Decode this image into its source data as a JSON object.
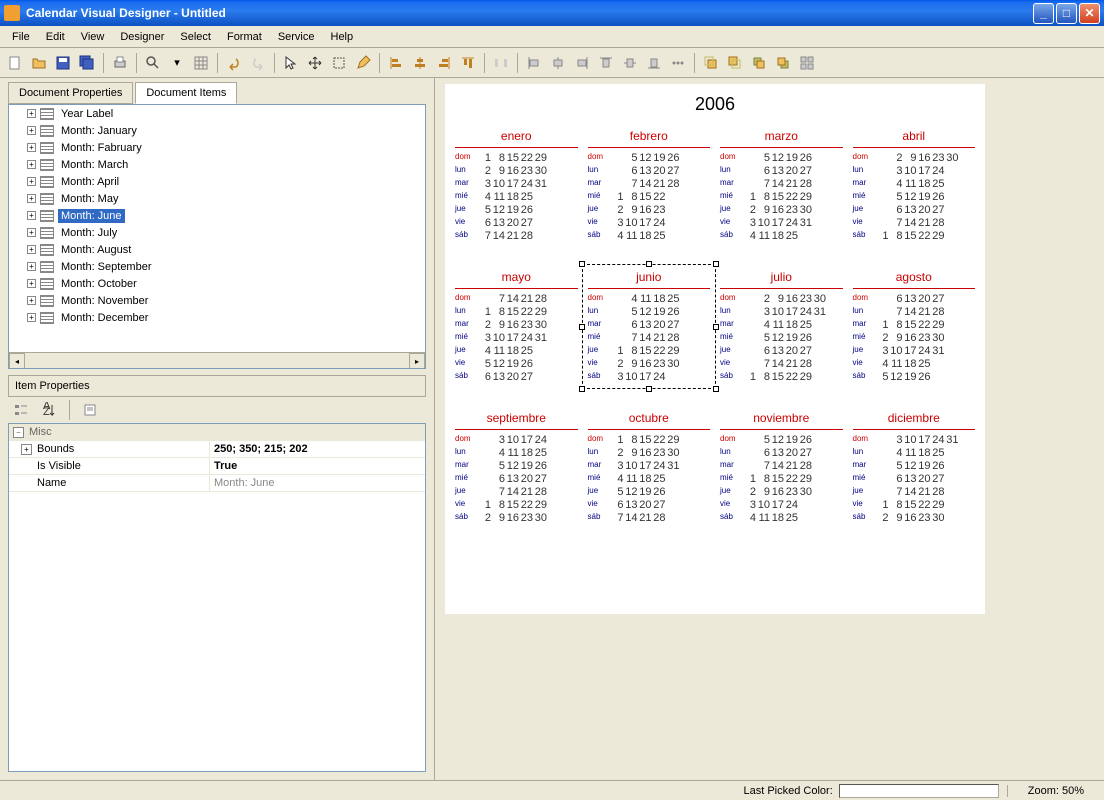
{
  "window": {
    "title": "Calendar Visual Designer - Untitled"
  },
  "menu": {
    "file": "File",
    "edit": "Edit",
    "view": "View",
    "designer": "Designer",
    "select": "Select",
    "format": "Format",
    "service": "Service",
    "help": "Help"
  },
  "tabs": {
    "docprops": "Document Properties",
    "docitems": "Document Items"
  },
  "tree": {
    "yearlabel": "Year Label",
    "m0": "Month: January",
    "m1": "Month: Fabruary",
    "m2": "Month: March",
    "m3": "Month: April",
    "m4": "Month: May",
    "m5": "Month: June",
    "m6": "Month: July",
    "m7": "Month: August",
    "m8": "Month: September",
    "m9": "Month: October",
    "m10": "Month: November",
    "m11": "Month: December"
  },
  "itemprops": {
    "header": "Item Properties",
    "catmisc": "Misc",
    "bounds_label": "Bounds",
    "bounds_val": "250; 350; 215; 202",
    "visible_label": "Is Visible",
    "visible_val": "True",
    "name_label": "Name",
    "name_val": "Month: June"
  },
  "calendar": {
    "year": "2006",
    "daynames": [
      "dom",
      "lun",
      "mar",
      "mié",
      "jue",
      "vie",
      "sáb"
    ],
    "months": [
      {
        "name": "enero",
        "start": 0,
        "days": 31
      },
      {
        "name": "febrero",
        "start": 3,
        "days": 28
      },
      {
        "name": "marzo",
        "start": 3,
        "days": 31
      },
      {
        "name": "abril",
        "start": 6,
        "days": 30
      },
      {
        "name": "mayo",
        "start": 1,
        "days": 31
      },
      {
        "name": "junio",
        "start": 4,
        "days": 30
      },
      {
        "name": "julio",
        "start": 6,
        "days": 31
      },
      {
        "name": "agosto",
        "start": 2,
        "days": 31
      },
      {
        "name": "septiembre",
        "start": 5,
        "days": 30
      },
      {
        "name": "octubre",
        "start": 0,
        "days": 31
      },
      {
        "name": "noviembre",
        "start": 3,
        "days": 30
      },
      {
        "name": "diciembre",
        "start": 5,
        "days": 31
      }
    ],
    "selected_month_index": 5
  },
  "status": {
    "lastcolor": "Last Picked Color:",
    "zoom": "Zoom: 50%"
  }
}
